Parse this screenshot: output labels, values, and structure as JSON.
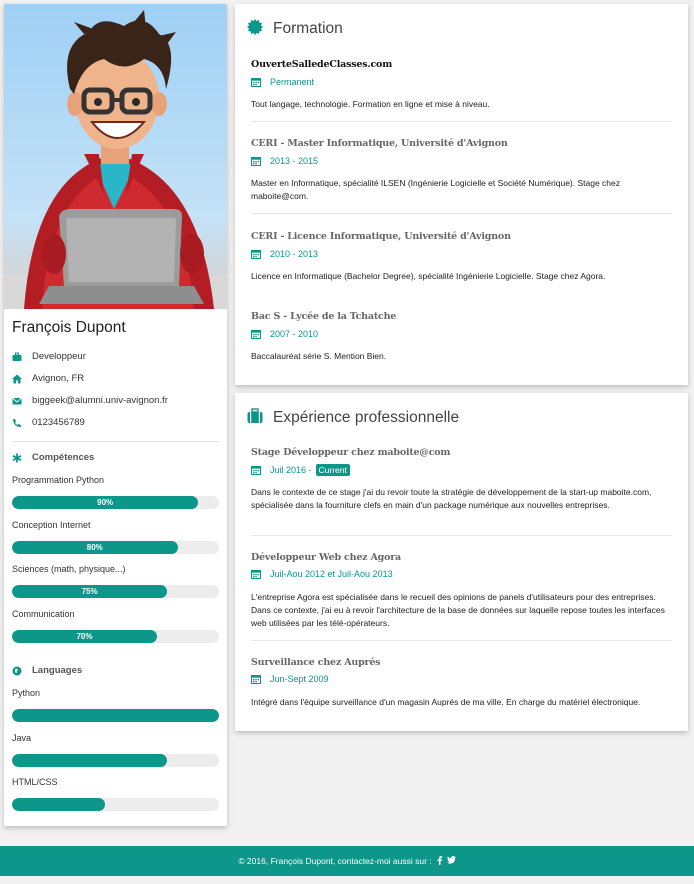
{
  "profile": {
    "name": "François Dupont",
    "job": "Developpeur",
    "location": "Avignon, FR",
    "email": "biggeek@alumni.univ-avignon.fr",
    "phone": "0123456789"
  },
  "competences": {
    "title": "Compétences",
    "skills": [
      {
        "label": "Programmation Python",
        "value_text": "90%",
        "percent": 90
      },
      {
        "label": "Conception Internet",
        "value_text": "80%",
        "percent": 80
      },
      {
        "label": "Sciences (math, physique...)",
        "value_text": "75%",
        "percent": 75
      },
      {
        "label": "Communication",
        "value_text": "70%",
        "percent": 70
      }
    ]
  },
  "languages": {
    "title": "Languages",
    "items": [
      {
        "label": "Python",
        "percent": 100
      },
      {
        "label": "Java",
        "percent": 75
      },
      {
        "label": "HTML/CSS",
        "percent": 45
      }
    ]
  },
  "formation": {
    "title": "Formation",
    "entries": [
      {
        "title": "OuverteSalledeClasses.com",
        "date": "Permanent",
        "desc": "Tout langage, technologie. Formation en ligne et mise à niveau."
      },
      {
        "title": "CERI - Master Informatique, Université d'Avignon",
        "date": "2013 - 2015",
        "desc": "Master en Informatique, spécialité ILSEN (Ingénierie Logicielle et Société Numérique). Stage chez maboite@com."
      },
      {
        "title": "CERI - Licence Informatique, Université d'Avignon",
        "date": "2010 - 2013",
        "desc": "Licence en Informatique (Bachelor Degree), spécialité Ingénierie Logicielle. Stage chez Agora."
      },
      {
        "title": "Bac S - Lycée de la Tchatche",
        "date": "2007 - 2010",
        "desc": "Baccalauréat série S. Mention Bien."
      }
    ]
  },
  "experience": {
    "title": "Expérience professionnelle",
    "entries": [
      {
        "title": "Stage Développeur chez maboite@com",
        "date": "Juil 2016 -",
        "badge": "Current",
        "desc": "Dans le contexte de ce stage j'ai du revoir toute la stratégie de développement de la start-up maboite.com, spécialisée dans la fourniture clefs en main d'un package numérique aux nouvelles entreprises."
      },
      {
        "title": "Développeur Web chez Agora",
        "date": "Juil-Aou 2012 et Juil-Aou 2013",
        "desc": "L'entreprise Agora est spécialisée dans le recueil des opinions de panels d'utilisateurs pour des entreprises. Dans ce contexte, j'ai eu à revoir l'architecture de la base de données sur laquelle repose toutes les interfaces web utilisées par les télé-opérateurs."
      },
      {
        "title": "Surveillance chez Auprés",
        "date": "Jun-Sept 2009",
        "desc": "Intégré dans l'équipe surveillance d'un magasin Auprés de ma ville. En charge du matériel électronique."
      }
    ]
  },
  "footer": {
    "text": "©   2016, François Dupont, contactez-moi aussi sur :"
  },
  "colors": {
    "accent": "#0d968a"
  }
}
